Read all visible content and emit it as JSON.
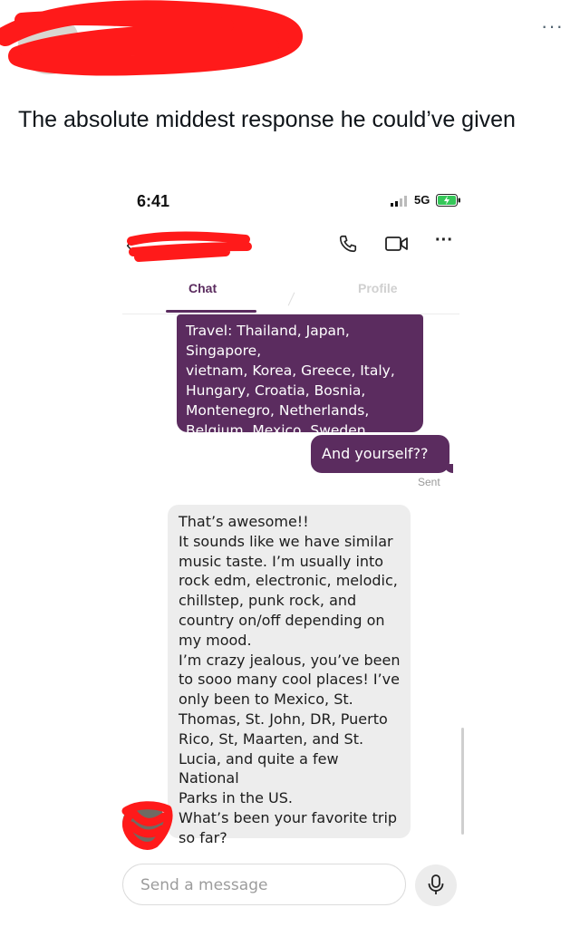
{
  "post": {
    "more_label": "···",
    "text": "The absolute middest response he could’ve given"
  },
  "screenshot": {
    "status": {
      "time": "6:41",
      "network": "5G"
    },
    "tabs": [
      {
        "label": "Chat"
      },
      {
        "label": "Profile"
      }
    ],
    "messages": {
      "outgoing_1": "Travel: Thailand, Japan, Singapore,\nvietnam, Korea, Greece, Italy,\nHungary, Croatia, Bosnia,\nMontenegro, Netherlands,\nBelgium, Mexico, Sweden",
      "outgoing_2": "And yourself??",
      "outgoing_status": "Sent",
      "incoming_1": "That’s awesome!!\nIt sounds like we have similar\nmusic taste. I’m usually into\nrock edm, electronic, melodic,\nchillstep, punk rock, and\ncountry on/off depending on\nmy mood.\nI’m crazy jealous, you’ve been\nto sooo many cool places! I’ve\nonly been to Mexico, St.\nThomas, St. John, DR, Puerto\nRico, St, Maarten, and St.\nLucia, and quite a few National\nParks in the US.\nWhat’s been your favorite trip\nso far?"
    },
    "composer": {
      "placeholder": "Send a message"
    }
  },
  "colors": {
    "accent": "#5b2c5f",
    "incoming_bubble": "#ededed",
    "redaction": "#ff1a1a"
  },
  "icons": [
    "more-dots-icon",
    "back-arrow-icon",
    "phone-icon",
    "video-camera-icon",
    "options-icon",
    "microphone-icon",
    "signal-icon",
    "battery-icon"
  ]
}
